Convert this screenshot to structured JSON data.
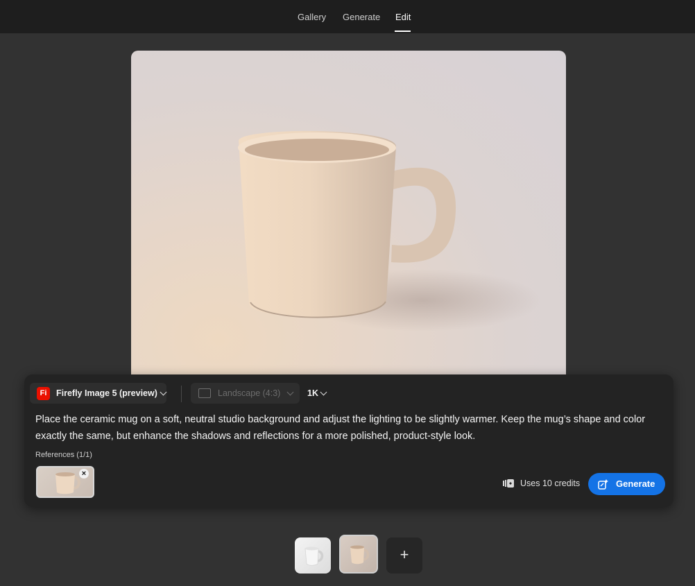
{
  "nav": {
    "tabs": [
      {
        "label": "Gallery",
        "active": false
      },
      {
        "label": "Generate",
        "active": false
      },
      {
        "label": "Edit",
        "active": true
      }
    ]
  },
  "canvas": {
    "subject": "ceramic mug on studio background"
  },
  "panel": {
    "model": {
      "logo": "Fi",
      "label": "Firefly Image 5 (preview)"
    },
    "aspect": {
      "label": "Landscape (4:3)",
      "disabled": true
    },
    "resolution": {
      "label": "1K"
    },
    "prompt": "Place the ceramic mug on a soft, neutral studio background and adjust the lighting to be slightly warmer. Keep the mug’s shape and color exactly the same, but enhance the shadows and reflections for a more polished, product-style look.",
    "references_label": "References (1/1)",
    "credits_label": "Uses 10 credits",
    "generate_label": "Generate",
    "accent_color": "#1473e6"
  },
  "thumbnails": {
    "add_label": "+"
  }
}
